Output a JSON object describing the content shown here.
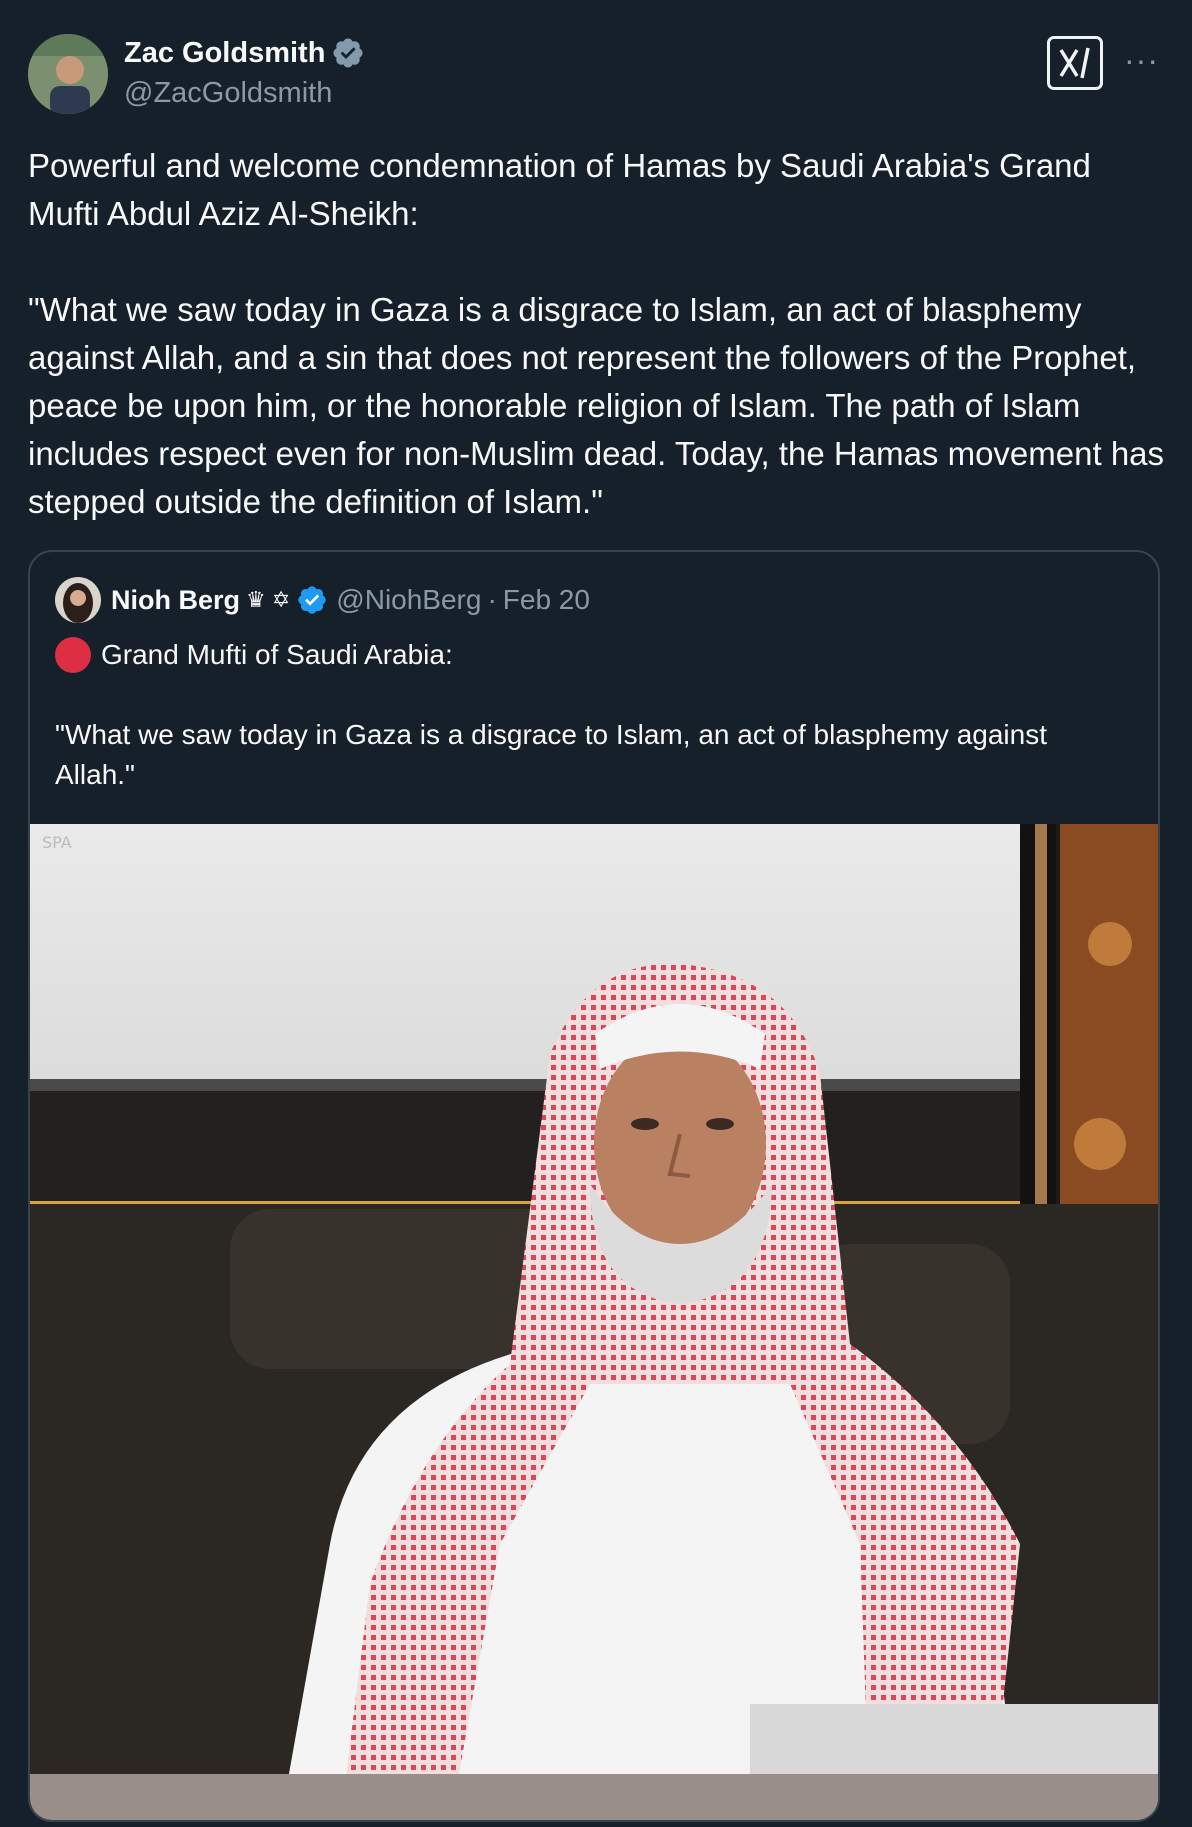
{
  "author": {
    "display_name": "Zac Goldsmith",
    "handle": "@ZacGoldsmith",
    "verified_badge": "grey-verified-icon"
  },
  "post": {
    "text": "Powerful and welcome condemnation of Hamas by Saudi Arabia's Grand Mufti Abdul Aziz Al-Sheikh:\n\n\"What we saw today in Gaza is a disgrace to Islam, an act of blasphemy against Allah, and a sin that does not represent the followers of the Prophet, peace be upon him, or the honorable religion of Islam. The path of Islam includes respect even for non-Muslim dead. Today, the Hamas movement has stepped outside the definition of Islam.\""
  },
  "quoted": {
    "display_name": "Nioh Berg",
    "name_emojis": "♛ ✡",
    "handle": "@NiohBerg",
    "separator": "·",
    "date": "Feb 20",
    "line1": "Grand Mufti of Saudi Arabia:",
    "quote": "\"What we saw today in Gaza is a disgrace to Islam, an act of blasphemy against Allah.\"",
    "verified_color": "#1d9bf0"
  },
  "colors": {
    "background": "#15202b",
    "text": "#f7f9f9",
    "muted": "#8b98a5",
    "border": "#38444d"
  }
}
